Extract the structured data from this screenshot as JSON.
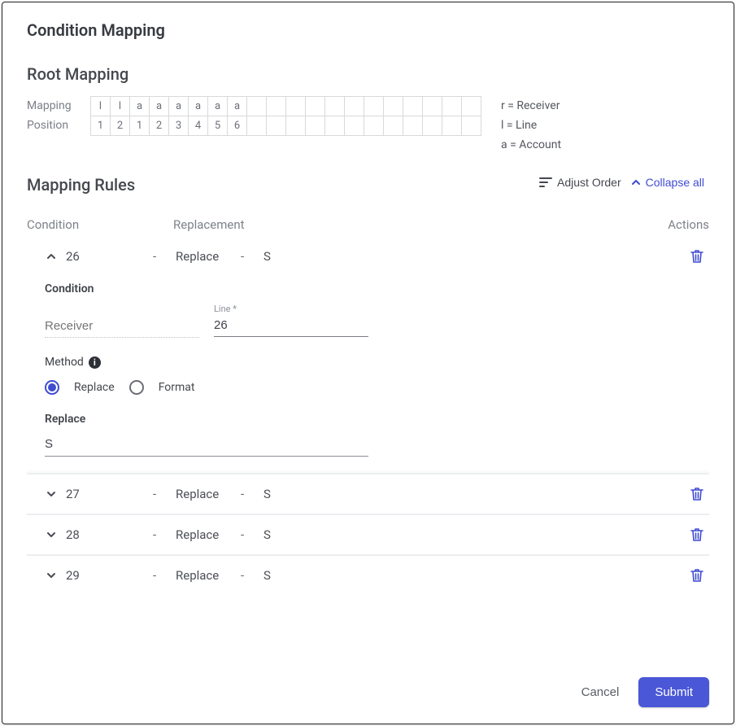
{
  "title": "Condition Mapping",
  "root": {
    "heading": "Root Mapping",
    "mapping_label": "Mapping",
    "position_label": "Position",
    "mapping_cells": [
      "l",
      "l",
      "a",
      "a",
      "a",
      "a",
      "a",
      "a",
      "",
      "",
      "",
      "",
      "",
      "",
      "",
      "",
      "",
      "",
      "",
      ""
    ],
    "position_cells": [
      "1",
      "2",
      "1",
      "2",
      "3",
      "4",
      "5",
      "6",
      "",
      "",
      "",
      "",
      "",
      "",
      "",
      "",
      "",
      "",
      "",
      ""
    ],
    "legend": {
      "r": "r = Receiver",
      "l": "l = Line",
      "a": "a = Account"
    }
  },
  "rules": {
    "heading": "Mapping Rules",
    "adjust_label": "Adjust Order",
    "collapse_label": "Collapse all",
    "columns": {
      "condition": "Condition",
      "replacement": "Replacement",
      "actions": "Actions"
    },
    "items": [
      {
        "id": "26",
        "method": "Replace",
        "value": "S",
        "expanded": true
      },
      {
        "id": "27",
        "method": "Replace",
        "value": "S",
        "expanded": false
      },
      {
        "id": "28",
        "method": "Replace",
        "value": "S",
        "expanded": false
      },
      {
        "id": "29",
        "method": "Replace",
        "value": "S",
        "expanded": false
      }
    ],
    "dash": "-"
  },
  "details": {
    "condition_label": "Condition",
    "receiver_label": "Receiver",
    "receiver_value": "",
    "line_label": "Line *",
    "line_value": "26",
    "method_label": "Method",
    "radio_replace": "Replace",
    "radio_format": "Format",
    "replace_label": "Replace",
    "replace_value": "S"
  },
  "footer": {
    "cancel": "Cancel",
    "submit": "Submit"
  }
}
